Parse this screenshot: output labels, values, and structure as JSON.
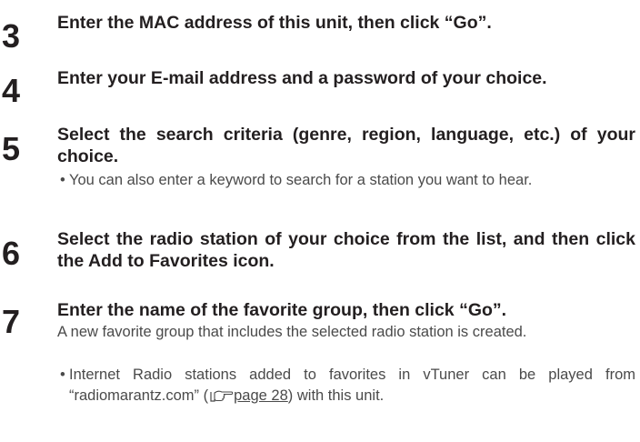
{
  "steps": [
    {
      "number": "3",
      "heading": "Enter the MAC address of this unit, then click “Go”."
    },
    {
      "number": "4",
      "heading": "Enter your E-mail address and a password of your choice."
    },
    {
      "number": "5",
      "heading": "Select the search criteria (genre, region, language, etc.) of your choice.",
      "bullet": "You can also enter a keyword to search for a station you want to hear."
    },
    {
      "number": "6",
      "heading": "Select the radio station of your choice from the list, and then click the Add to Favorites icon."
    },
    {
      "number": "7",
      "heading": "Enter the name of the favorite group, then click “Go”.",
      "body": "A new favorite group that includes the selected radio station is created.",
      "bullet_before": "Internet Radio stations added to favorites in vTuner can be played from “radiomarantz.com” (",
      "bullet_link": "page 28",
      "bullet_after": ") with this unit."
    }
  ],
  "icons": {
    "reference": "pointing-hand-icon",
    "bullet_glyph": "•"
  }
}
